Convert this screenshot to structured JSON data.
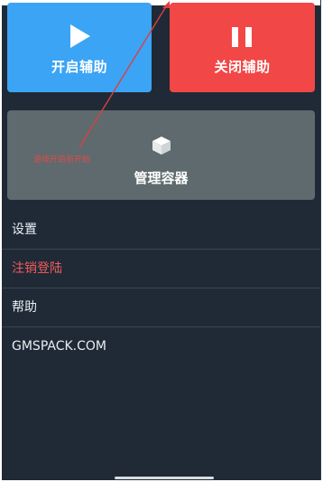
{
  "actions": {
    "start_label": "开启辅助",
    "stop_label": "关闭辅助",
    "manage_label": "管理容器",
    "annotation": "游戏开启前开始"
  },
  "menu": {
    "items": [
      {
        "label": "设置",
        "style": "normal"
      },
      {
        "label": "注销登陆",
        "style": "danger"
      },
      {
        "label": "帮助",
        "style": "normal"
      },
      {
        "label": "GMSPACK.COM",
        "style": "normal"
      }
    ]
  },
  "icons": {
    "start": "play-icon",
    "stop": "pause-icon",
    "manage": "cube-icon"
  },
  "colors": {
    "background": "#1f2a36",
    "start_button": "#3ba4f5",
    "stop_button": "#f24747",
    "container_card": "#5e6a6e",
    "danger_text": "#f25b5b",
    "annotation": "#e24a4a"
  }
}
